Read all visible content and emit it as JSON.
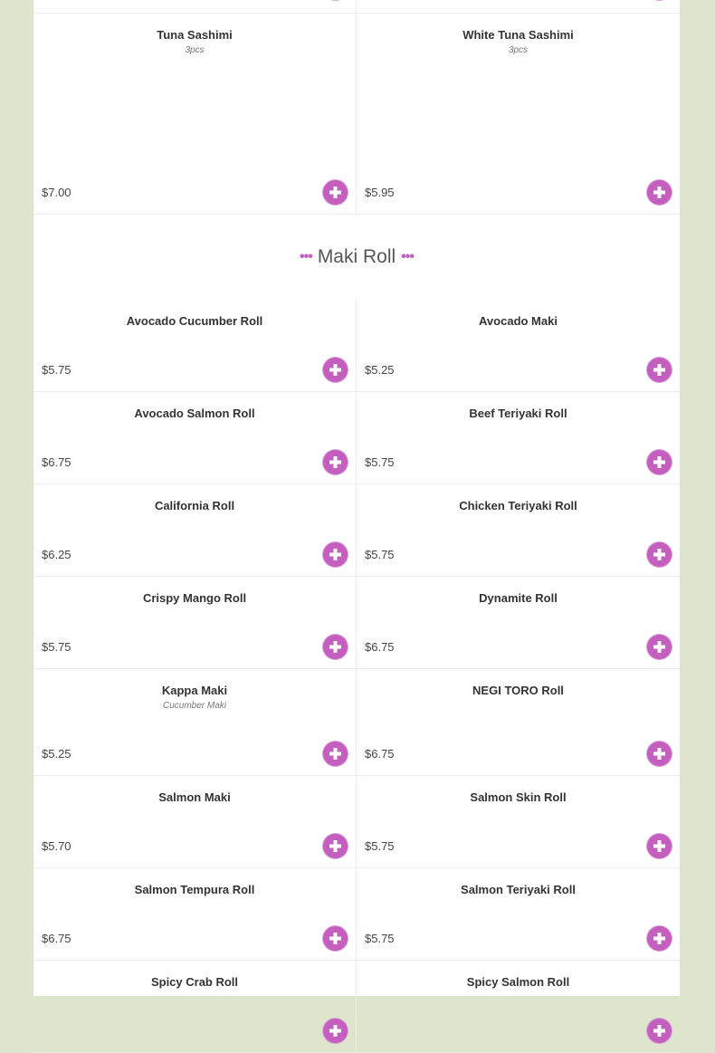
{
  "sashimi_rows": [
    [
      {
        "name": "Tuna Sashimi",
        "sub": "3pcs",
        "price": "$7.00"
      },
      {
        "name": "White Tuna Sashimi",
        "sub": "3pcs",
        "price": "$5.95"
      }
    ]
  ],
  "section": {
    "title": "Maki Roll"
  },
  "maki_rows": [
    [
      {
        "name": "Avocado Cucumber Roll",
        "sub": "",
        "price": "$5.75"
      },
      {
        "name": "Avocado Maki",
        "sub": "",
        "price": "$5.25"
      }
    ],
    [
      {
        "name": "Avocado Salmon Roll",
        "sub": "",
        "price": "$6.75"
      },
      {
        "name": "Beef Teriyaki Roll",
        "sub": "",
        "price": "$5.75"
      }
    ],
    [
      {
        "name": "California Roll",
        "sub": "",
        "price": "$6.25"
      },
      {
        "name": "Chicken Teriyaki Roll",
        "sub": "",
        "price": "$5.75"
      }
    ],
    [
      {
        "name": "Crispy Mango Roll",
        "sub": "",
        "price": "$5.75"
      },
      {
        "name": "Dynamite Roll",
        "sub": "",
        "price": "$6.75"
      }
    ],
    [
      {
        "name": "Kappa Maki",
        "sub": "Cucumber Maki",
        "price": "$5.25"
      },
      {
        "name": "NEGI TORO Roll",
        "sub": "",
        "price": "$6.75"
      }
    ],
    [
      {
        "name": "Salmon Maki",
        "sub": "",
        "price": "$5.70"
      },
      {
        "name": "Salmon Skin Roll",
        "sub": "",
        "price": "$5.75"
      }
    ],
    [
      {
        "name": "Salmon Tempura Roll",
        "sub": "",
        "price": "$6.75"
      },
      {
        "name": "Salmon Teriyaki Roll",
        "sub": "",
        "price": "$5.75"
      }
    ],
    [
      {
        "name": "Spicy Crab Roll",
        "sub": "",
        "price": ""
      },
      {
        "name": "Spicy Salmon Roll",
        "sub": "",
        "price": ""
      }
    ]
  ],
  "colors": {
    "accent": "#c45fc0",
    "background": "#dde6cd",
    "card": "#ffffff"
  },
  "icons": {
    "add": "plus-circle-icon",
    "divider": "dots-icon"
  }
}
